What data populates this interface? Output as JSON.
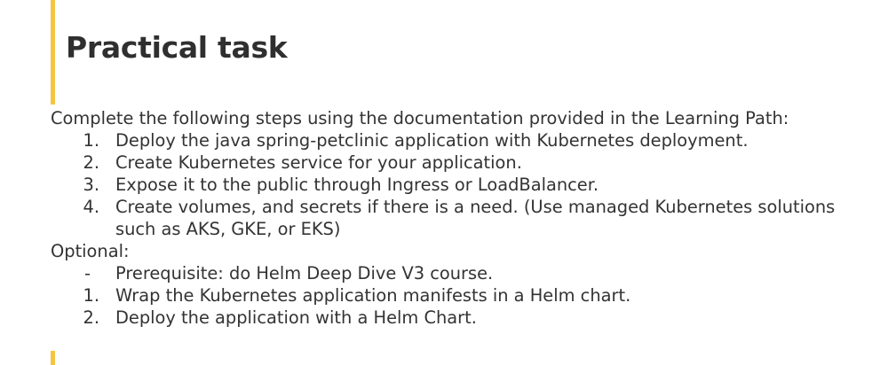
{
  "title": "Practical task",
  "intro": "Complete the following steps using the documentation provided in the Learning Path:",
  "steps": [
    {
      "n": "1.",
      "text": "Deploy the java spring-petclinic application with Kubernetes deployment."
    },
    {
      "n": "2.",
      "text": "Create Kubernetes service for your application."
    },
    {
      "n": "3.",
      "text": "Expose it to the public through Ingress or LoadBalancer."
    },
    {
      "n": "4.",
      "text": "Create volumes, and secrets if there is a need. (Use managed Kubernetes solutions such as AKS, GKE, or EKS)"
    }
  ],
  "optional_label": "Optional:",
  "optional": {
    "prereq_marker": "-",
    "prereq_text": "Prerequisite: do Helm Deep Dive V3 course.",
    "items": [
      {
        "n": "1.",
        "text": "Wrap the Kubernetes application manifests in a Helm chart."
      },
      {
        "n": "2.",
        "text": "Deploy the application with a Helm Chart."
      }
    ]
  },
  "colors": {
    "accent": "#f5c542",
    "text": "#333333"
  }
}
